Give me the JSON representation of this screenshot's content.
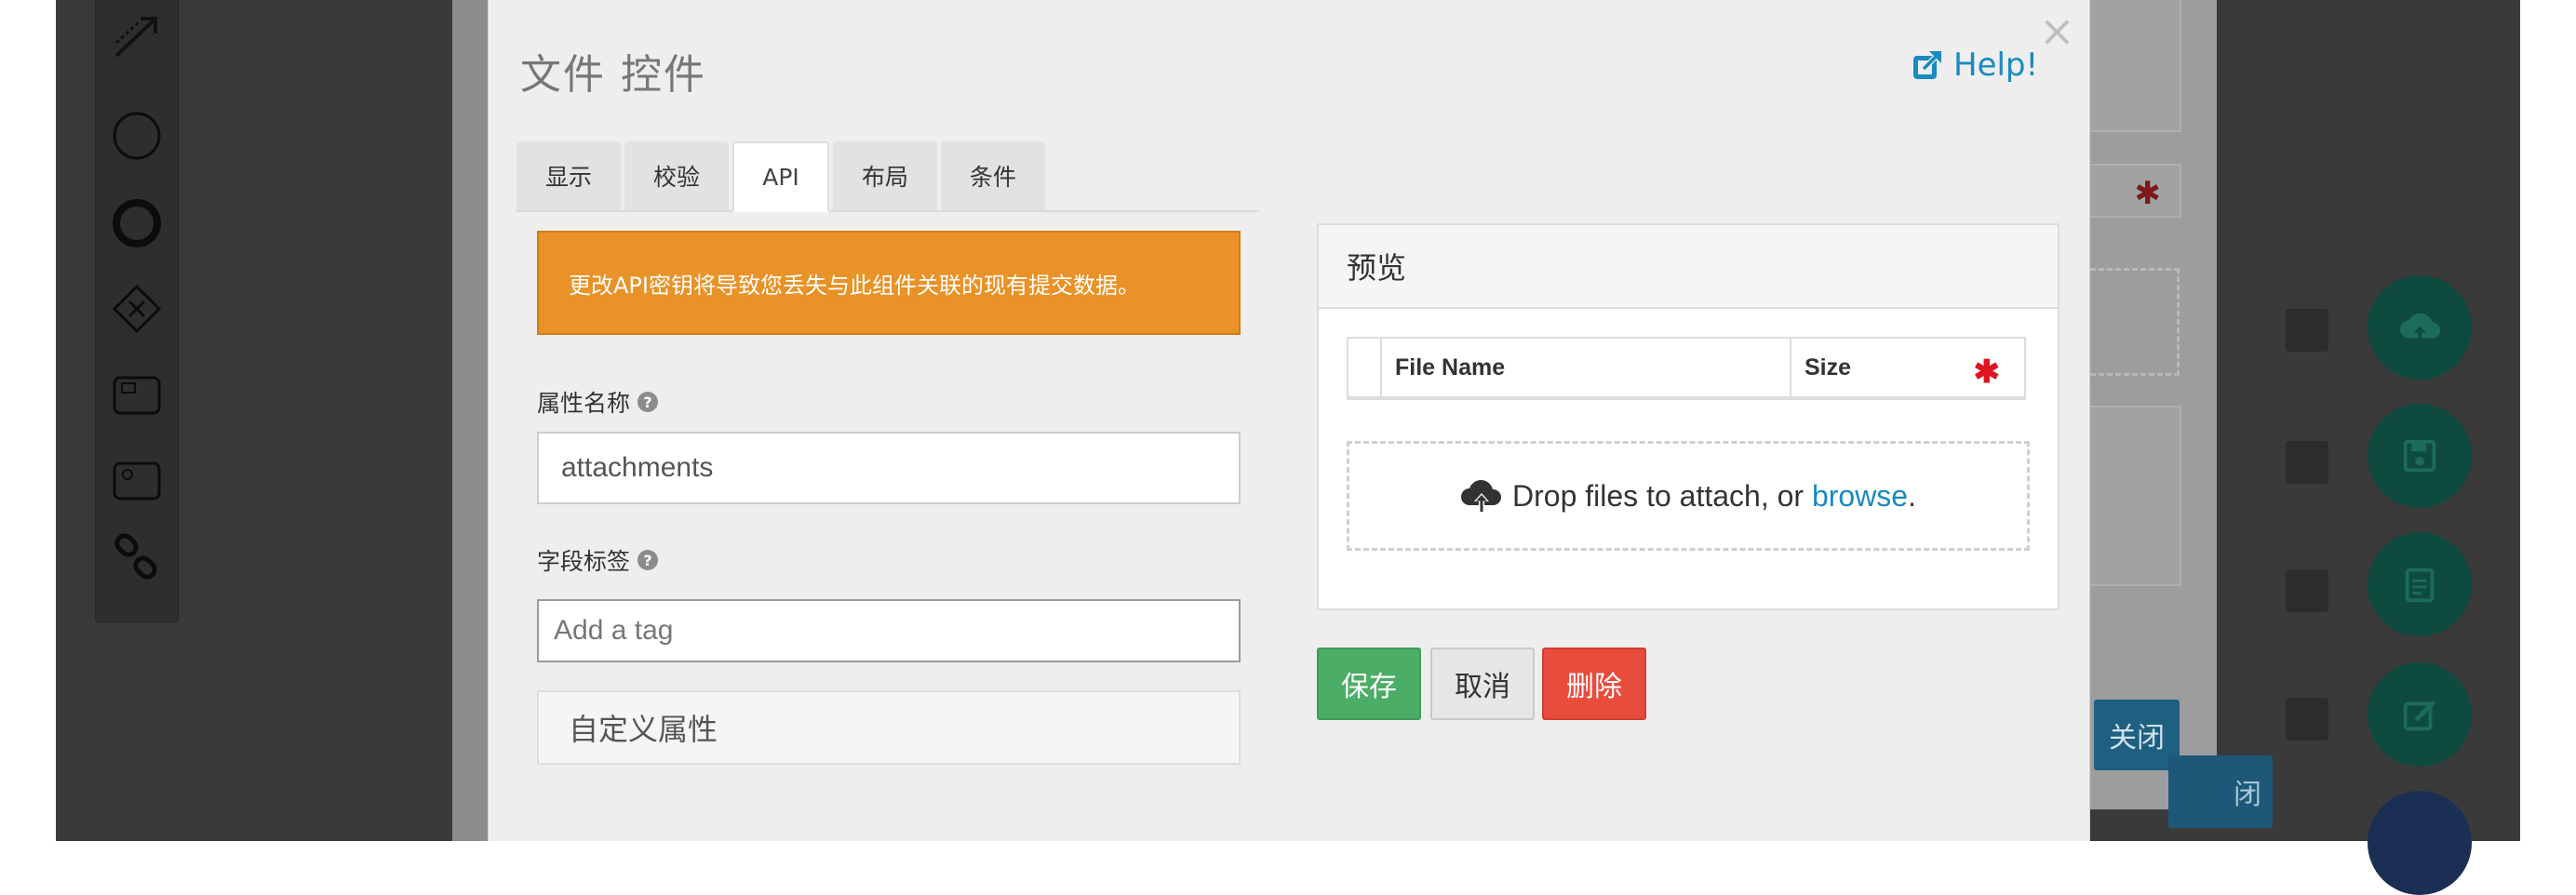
{
  "modal": {
    "title": "文件 控件",
    "help_label": "Help!",
    "close_symbol": "×",
    "tabs": [
      {
        "label": "显示",
        "active": false
      },
      {
        "label": "校验",
        "active": false
      },
      {
        "label": "API",
        "active": true
      },
      {
        "label": "布局",
        "active": false
      },
      {
        "label": "条件",
        "active": false
      }
    ],
    "warning_text": "更改API密钥将导致您丢失与此组件关联的现有提交数据。",
    "property_name": {
      "label": "属性名称",
      "value": "attachments"
    },
    "field_tags": {
      "label": "字段标签",
      "placeholder": "Add a tag"
    },
    "custom_properties_label": "自定义属性",
    "preview": {
      "title": "预览",
      "table_headers": {
        "file_name": "File Name",
        "size": "Size"
      },
      "required_marker": "✱",
      "dropzone_text": "Drop files to attach, or",
      "browse_label": "browse",
      "dropzone_suffix": "."
    },
    "buttons": {
      "save": "保存",
      "cancel": "取消",
      "delete": "删除"
    }
  },
  "background": {
    "close_button_label": "关闭",
    "close_button_label_2": "闭",
    "toolbox_icons": [
      "connector-arrow-icon",
      "circle-icon",
      "bold-circle-icon",
      "gateway-diamond-icon",
      "task-icon",
      "subprocess-icon",
      "link-icon"
    ],
    "fab_icons": [
      "cloud-upload-icon",
      "save-icon",
      "clipboard-icon",
      "edit-icon",
      "more-icon"
    ]
  },
  "colors": {
    "warning": "#e89227",
    "save": "#4cad66",
    "delete": "#e74c3c",
    "link": "#1a8ac0",
    "fab": "#0f4a3f"
  }
}
